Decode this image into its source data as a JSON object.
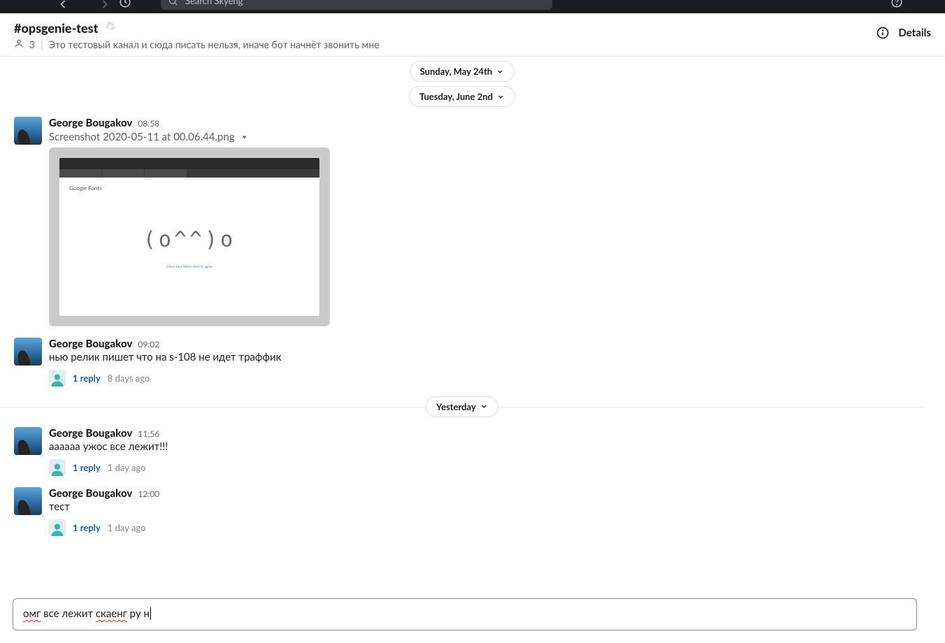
{
  "topbar": {
    "search_placeholder": "Search Skyeng"
  },
  "channel": {
    "name": "#opsgenie-test",
    "member_count": "3",
    "topic": "Это тестовый канал и сюда писать нельзя, иначе бот начнёт звонить мне",
    "details_label": "Details"
  },
  "dividers": {
    "d1": "Sunday, May 24th",
    "d2": "Tuesday, June 2nd",
    "d3": "Yesterday"
  },
  "messages": [
    {
      "author": "George Bougakov",
      "time": "08:58",
      "file_name": "Screenshot 2020-05-11 at 00.06.44.png",
      "screenshot": {
        "brand": "Google Fonts",
        "ascii": "(o^^)o",
        "sub": "Clear your filters and try again"
      }
    },
    {
      "author": "George Bougakov",
      "time": "09:02",
      "text": "нью релик пишет что на s-108 не идет траффик",
      "thread": {
        "replies": "1 reply",
        "ago": "8 days ago"
      }
    },
    {
      "author": "George Bougakov",
      "time": "11:56",
      "text": "aaaaaa ужос все лежит!!!",
      "thread": {
        "replies": "1 reply",
        "ago": "1 day ago"
      }
    },
    {
      "author": "George Bougakov",
      "time": "12:00",
      "text": "тест",
      "thread": {
        "replies": "1 reply",
        "ago": "1 day ago"
      }
    }
  ],
  "composer": {
    "text_parts": {
      "w1": "омг",
      "sp1": " все лежит ",
      "w2": "скаенг",
      "sp2": " ру н"
    }
  }
}
